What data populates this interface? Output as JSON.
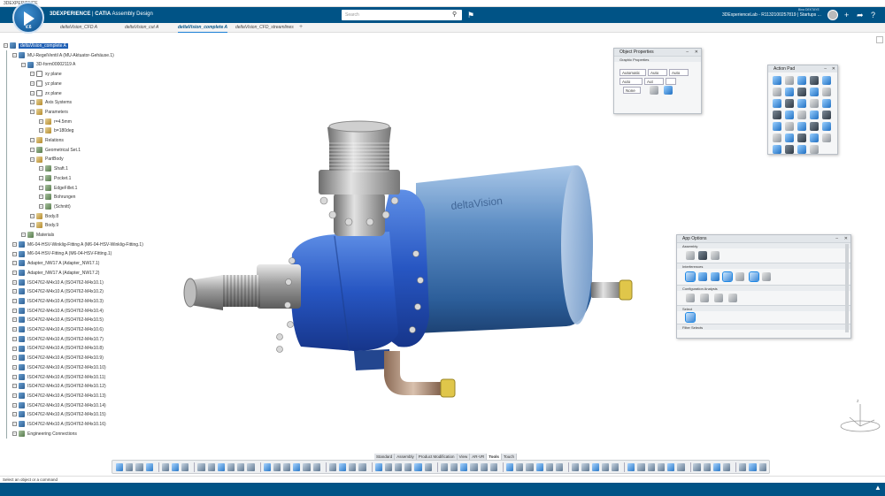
{
  "window_title": "3DEXPERIENCE",
  "topbar": {
    "brand_ds": "3D",
    "brand_experience": "EXPERIENCE",
    "brand_separator": " | ",
    "brand_app": "CATIA",
    "brand_module": "Assembly Design",
    "compass_version": "V.6",
    "search_placeholder": "Search",
    "lab_text": "3DExperienceLab - R1132100257819 | Startups ...",
    "mini_text": "Bina DEKTAYE",
    "accent": "#005386"
  },
  "tabs": [
    {
      "label": "deltaVision_CFD A",
      "active": false
    },
    {
      "label": "deltaVision_cut A",
      "active": false
    },
    {
      "label": "deltaVision_complete A",
      "active": true
    },
    {
      "label": "deltaVision_CFD_streamlines",
      "active": false
    }
  ],
  "tree": {
    "nodes": [
      {
        "label": "deltaVision_complete A",
        "indent": 0,
        "icon": "assembly",
        "selected": true
      },
      {
        "label": "MU-RegelVentil A (MU-Aktuator-Gehäuse.1)",
        "indent": 1,
        "icon": "part"
      },
      {
        "label": "3D-form00002119 A",
        "indent": 2,
        "icon": "part"
      },
      {
        "label": "xy plane",
        "indent": 3,
        "icon": "plane"
      },
      {
        "label": "yz plane",
        "indent": 3,
        "icon": "plane"
      },
      {
        "label": "zx plane",
        "indent": 3,
        "icon": "plane"
      },
      {
        "label": "Axis Systems",
        "indent": 3,
        "icon": "axis"
      },
      {
        "label": "Parameters",
        "indent": 3,
        "icon": "param"
      },
      {
        "label": "r=4.5mm",
        "indent": 4,
        "icon": "param"
      },
      {
        "label": "b=180deg",
        "indent": 4,
        "icon": "param"
      },
      {
        "label": "Relations",
        "indent": 3,
        "icon": "param"
      },
      {
        "label": "Geometrical Set.1",
        "indent": 3,
        "icon": "geo"
      },
      {
        "label": "PartBody",
        "indent": 3,
        "icon": "body"
      },
      {
        "label": "Shaft.1",
        "indent": 4,
        "icon": "feature"
      },
      {
        "label": "Pocket.1",
        "indent": 4,
        "icon": "feature"
      },
      {
        "label": "EdgeFillet.1",
        "indent": 4,
        "icon": "feature"
      },
      {
        "label": "Bohrungen",
        "indent": 4,
        "icon": "feature"
      },
      {
        "label": "(Schnitt)",
        "indent": 4,
        "icon": "feature"
      },
      {
        "label": "Body.8",
        "indent": 3,
        "icon": "body"
      },
      {
        "label": "Body.9",
        "indent": 3,
        "icon": "body"
      },
      {
        "label": "Materials",
        "indent": 2,
        "icon": "geo"
      },
      {
        "label": "M6-04-HSV-Winklig-Fitting A (M6-04-HSV-Winklig-Fitting.1)",
        "indent": 1,
        "icon": "part"
      },
      {
        "label": "M6-04-HSV-Fitting A (M6-04-HSV-Fitting.1)",
        "indent": 1,
        "icon": "part"
      },
      {
        "label": "Adapter_NW17 A (Adapter_NW17.1)",
        "indent": 1,
        "icon": "part"
      },
      {
        "label": "Adapter_NW17 A (Adapter_NW17.2)",
        "indent": 1,
        "icon": "part"
      },
      {
        "label": "ISO4762-M4x10 A (ISO4762-M4x10.1)",
        "indent": 1,
        "icon": "part"
      },
      {
        "label": "ISO4762-M4x10 A (ISO4762-M4x10.2)",
        "indent": 1,
        "icon": "part"
      },
      {
        "label": "ISO4762-M4x10 A (ISO4762-M4x10.3)",
        "indent": 1,
        "icon": "part"
      },
      {
        "label": "ISO4762-M4x10 A (ISO4762-M4x10.4)",
        "indent": 1,
        "icon": "part"
      },
      {
        "label": "ISO4762-M4x10 A (ISO4762-M4x10.5)",
        "indent": 1,
        "icon": "part"
      },
      {
        "label": "ISO4762-M4x10 A (ISO4762-M4x10.6)",
        "indent": 1,
        "icon": "part"
      },
      {
        "label": "ISO4762-M4x10 A (ISO4762-M4x10.7)",
        "indent": 1,
        "icon": "part"
      },
      {
        "label": "ISO4762-M4x10 A (ISO4762-M4x10.8)",
        "indent": 1,
        "icon": "part"
      },
      {
        "label": "ISO4762-M4x10 A (ISO4762-M4x10.9)",
        "indent": 1,
        "icon": "part"
      },
      {
        "label": "ISO4762-M4x10 A (ISO4762-M4x10.10)",
        "indent": 1,
        "icon": "part"
      },
      {
        "label": "ISO4762-M4x10 A (ISO4762-M4x10.11)",
        "indent": 1,
        "icon": "part"
      },
      {
        "label": "ISO4762-M4x10 A (ISO4762-M4x10.12)",
        "indent": 1,
        "icon": "part"
      },
      {
        "label": "ISO4762-M4x10 A (ISO4762-M4x10.13)",
        "indent": 1,
        "icon": "part"
      },
      {
        "label": "ISO4762-M4x10 A (ISO4762-M4x10.14)",
        "indent": 1,
        "icon": "part"
      },
      {
        "label": "ISO4762-M4x10 A (ISO4762-M4x10.15)",
        "indent": 1,
        "icon": "part"
      },
      {
        "label": "ISO4762-M4x10 A (ISO4762-M4x10.16)",
        "indent": 1,
        "icon": "part"
      },
      {
        "label": "Engineering Connections",
        "indent": 1,
        "icon": "geo"
      }
    ]
  },
  "object_properties": {
    "title": "Object Properties",
    "section": "Graphic Properties",
    "row1": [
      "Automatic",
      "Auto",
      "Auto"
    ],
    "row2": [
      "Auto",
      "Aut",
      ""
    ],
    "row3": [
      "None"
    ]
  },
  "action_pad": {
    "title": "Action Pad"
  },
  "app_options": {
    "title": "App Options",
    "sections": [
      "Assembly",
      "Interferences",
      "Configuration Analysis",
      "Select",
      "Filter Selects"
    ]
  },
  "command_tabs": [
    "Standard",
    "Assembly",
    "Product Modification",
    "View",
    "AR-VR",
    "Tools",
    "Touch"
  ],
  "active_command_tab": "Tools",
  "model_label": "deltaVision",
  "status_text": "Select an object or a command"
}
